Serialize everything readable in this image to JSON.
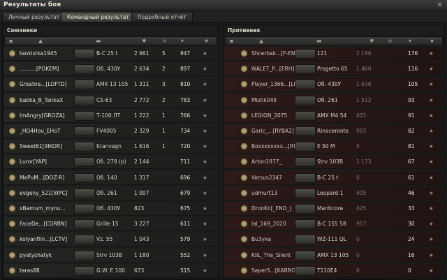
{
  "window": {
    "title": "Результаты боя",
    "close_glyph": "✕"
  },
  "tabs": [
    "Личный результат",
    "Командный результат",
    "Подробный отчёт"
  ],
  "allies": {
    "title": "Союзники",
    "rows": [
      {
        "player": "tankistka1945",
        "tank": "В-С 25 t",
        "damage": "2 961",
        "kills": "5",
        "xp": "947"
      },
      {
        "player": "..........[POKEM]",
        "tank": "Об. 430У",
        "damage": "2 634",
        "kills": "2",
        "xp": "897"
      },
      {
        "player": "Greatne...[LOFTD]",
        "tank": "AMX 13 105",
        "damage": "1 311",
        "kills": "3",
        "xp": "810"
      },
      {
        "player": "babka_B_TankaX",
        "tank": "CS-63",
        "damage": "2 772",
        "kills": "2",
        "xp": "783"
      },
      {
        "player": "ImAngry[GROZA]",
        "tank": "Т-100 ЛТ",
        "damage": "1 222",
        "kills": "1",
        "xp": "766"
      },
      {
        "player": "_HO4Hou_EHoT",
        "tank": "FV4005",
        "damage": "2 329",
        "kills": "1",
        "xp": "734"
      },
      {
        "player": "Sweet61[9IKOR]",
        "tank": "Kranvagn",
        "damage": "1 616",
        "kills": "1",
        "xp": "720"
      },
      {
        "player": "Luror[YAP]",
        "tank": "Об. 279 (р)",
        "damage": "2 144",
        "kills": "",
        "xp": "711"
      },
      {
        "player": "MePuM...[DOZ-R]",
        "tank": "Об. 140",
        "damage": "1 317",
        "kills": "",
        "xp": "696"
      },
      {
        "player": "evgeny_521[WPC]",
        "tank": "Об. 261",
        "damage": "1 007",
        "kills": "",
        "xp": "679"
      },
      {
        "player": "xBamum_mynu...",
        "tank": "Об. 430У",
        "damage": "823",
        "kills": "",
        "xp": "675"
      },
      {
        "player": "FaceDe...[CORBN]",
        "tank": "Grille 15",
        "damage": "3 227",
        "kills": "",
        "xp": "611"
      },
      {
        "player": "kolyanflin...[LCTV]",
        "tank": "Vz. 55",
        "damage": "1 043",
        "kills": "",
        "xp": "579"
      },
      {
        "player": "pyatyshatyk",
        "tank": "Strv 103B",
        "damage": "1 180",
        "kills": "",
        "xp": "552"
      },
      {
        "player": "taras88",
        "tank": "G.W. E 100",
        "damage": "673",
        "kills": "",
        "xp": "515"
      }
    ]
  },
  "enemies": {
    "title": "Противник",
    "rows": [
      {
        "player": "Shcerbak...[F-EN]",
        "tank": "121",
        "damage": "2 190",
        "kills": "",
        "xp": "176"
      },
      {
        "player": "WALET_P...[ERH]",
        "tank": "Progetto 65",
        "damage": "1 460",
        "kills": "",
        "xp": "116"
      },
      {
        "player": "Player_1366...[LICKY]",
        "tank": "Об. 430У",
        "damage": "1 636",
        "kills": "",
        "xp": "105"
      },
      {
        "player": "Mistik045",
        "tank": "Об. 261",
        "damage": "1 512",
        "kills": "",
        "xp": "93"
      },
      {
        "player": "LEGION_2075",
        "tank": "AMX M4 54",
        "damage": "415",
        "kills": "",
        "xp": "91"
      },
      {
        "player": "Garic_...[RYBA2]",
        "tank": "Rinoceronte",
        "damage": "993",
        "kills": "",
        "xp": "82"
      },
      {
        "player": "Boxxxxxxxx...[RICOM]",
        "tank": "E 50 M",
        "damage": "0",
        "kills": "",
        "xp": "81"
      },
      {
        "player": "Arton1977_",
        "tank": "Strv 103B",
        "damage": "1 173",
        "kills": "",
        "xp": "67"
      },
      {
        "player": "Versus2347",
        "tank": "B-C 25 t",
        "damage": "0",
        "kills": "",
        "xp": "61"
      },
      {
        "player": "udmurt13",
        "tank": "Leopard 1",
        "damage": "405",
        "kills": "",
        "xp": "46"
      },
      {
        "player": "DronKn[_END_]",
        "tank": "Manticore",
        "damage": "425",
        "kills": "",
        "xp": "33"
      },
      {
        "player": "lal_169_2020",
        "tank": "В-С 155 58",
        "damage": "957",
        "kills": "",
        "xp": "30"
      },
      {
        "player": "Bu3yxa",
        "tank": "WZ-111 QL",
        "damage": "0",
        "kills": "",
        "xp": "24"
      },
      {
        "player": "KiIL_The_Silent",
        "tank": "AMX 13 105",
        "damage": "0",
        "kills": "",
        "xp": "16"
      },
      {
        "player": "SeperS...[KARRO]",
        "tank": "T110E4",
        "damage": "0",
        "kills": "",
        "xp": "0"
      }
    ]
  }
}
